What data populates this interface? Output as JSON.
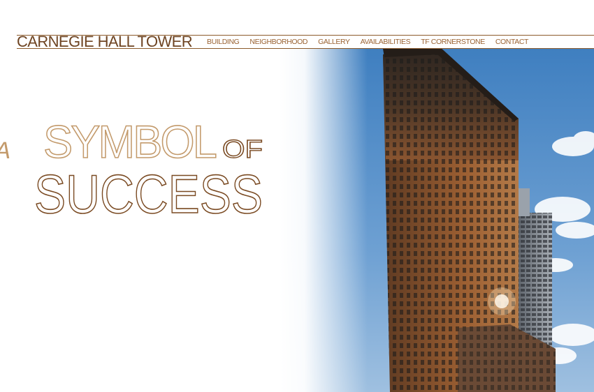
{
  "site": {
    "title": "CARNEGIE HALL TOWER"
  },
  "nav": {
    "items": [
      {
        "label": "BUILDING"
      },
      {
        "label": "NEIGHBORHOOD"
      },
      {
        "label": "GALLERY"
      },
      {
        "label": "AVAILABILITIES"
      },
      {
        "label": "TF CORNERSTONE"
      },
      {
        "label": "CONTACT"
      }
    ]
  },
  "hero": {
    "word_a": "A",
    "word_symbol": "SYMBOL",
    "word_of": "OF",
    "word_success": "SUCCESS"
  },
  "colors": {
    "brand_brown": "#6e4422",
    "nav_brown": "#9a6333",
    "headline_tan": "#c39a6b",
    "headline_brown": "#7a4a22",
    "sky_blue": "#4f8ac4"
  }
}
